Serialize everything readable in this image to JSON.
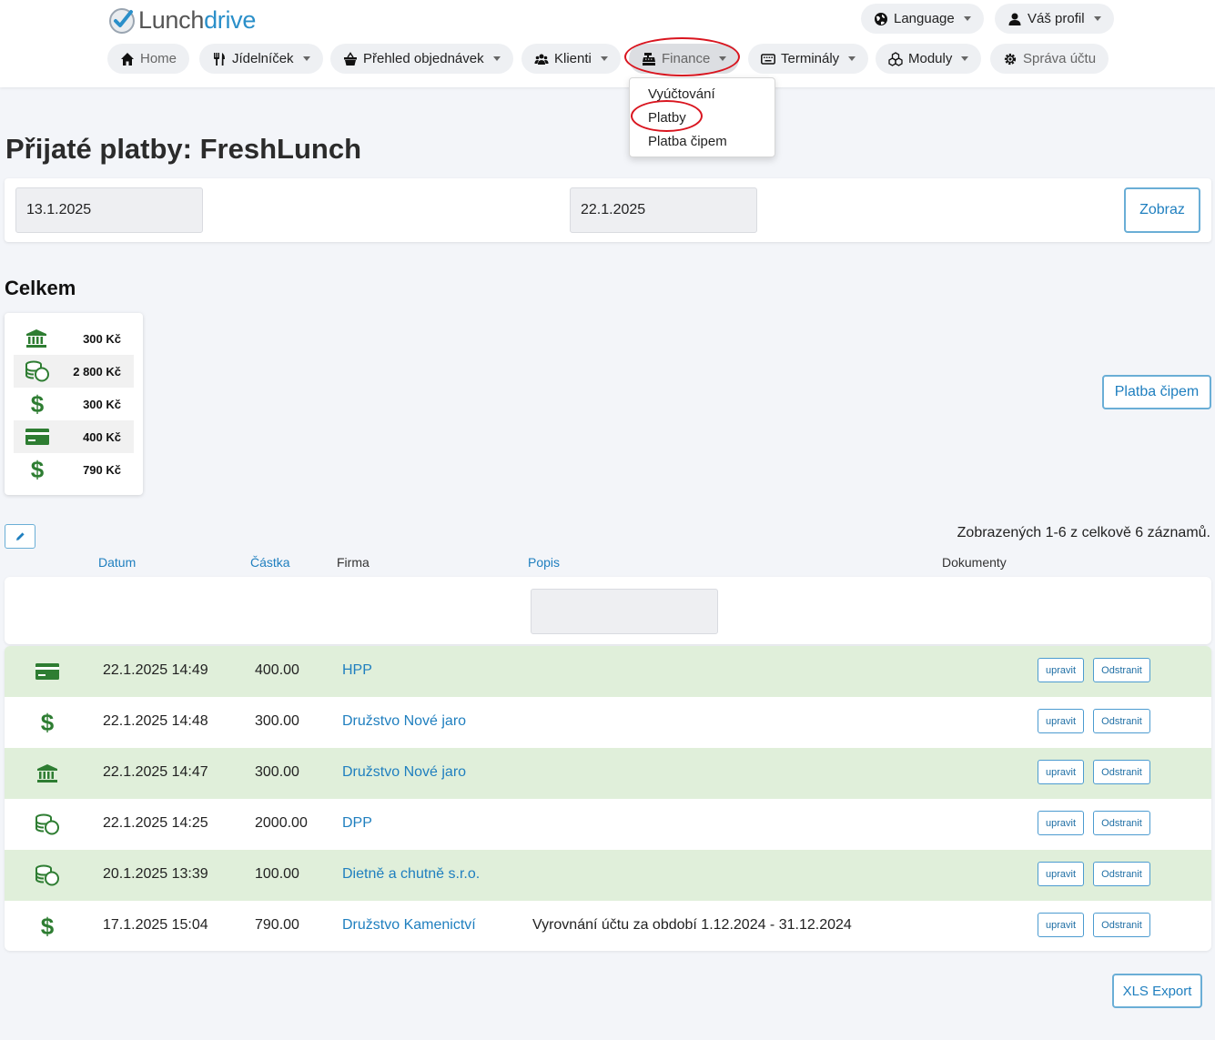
{
  "header": {
    "logo_part1": "Lunch",
    "logo_part2": "drive",
    "language": "Language",
    "profile": "Váš profil"
  },
  "nav": {
    "home": "Home",
    "menu": "Jídelníček",
    "orders": "Přehled objednávek",
    "clients": "Klienti",
    "finance": "Finance",
    "terminals": "Terminály",
    "modules": "Moduly",
    "account": "Správa účtu"
  },
  "finance_menu": {
    "items": [
      "Vyúčtování",
      "Platby",
      "Platba čipem"
    ]
  },
  "page": {
    "title": "Přijaté platby: FreshLunch"
  },
  "filter": {
    "date_from": "13.1.2025",
    "date_to": "22.1.2025",
    "show_button": "Zobraz"
  },
  "summary": {
    "heading": "Celkem",
    "rows": [
      {
        "icon": "bank-icon",
        "amount": "300 Kč"
      },
      {
        "icon": "coins-icon",
        "amount": "2 800 Kč"
      },
      {
        "icon": "dollar-icon",
        "amount": "300 Kč"
      },
      {
        "icon": "card-icon",
        "amount": "400 Kč"
      },
      {
        "icon": "dollar-icon",
        "amount": "790 Kč"
      }
    ]
  },
  "chip_payment_button": "Platba čipem",
  "records_info": "Zobrazených 1-6 z celkově 6 záznamů.",
  "table": {
    "headers": {
      "date": "Datum",
      "amount": "Částka",
      "firm": "Firma",
      "description": "Popis",
      "documents": "Dokumenty"
    },
    "rows": [
      {
        "icon": "card-icon",
        "date": "22.1.2025 14:49",
        "amount": "400.00",
        "firm": "HPP",
        "description": ""
      },
      {
        "icon": "dollar-icon",
        "date": "22.1.2025 14:48",
        "amount": "300.00",
        "firm": "Družstvo Nové jaro",
        "description": ""
      },
      {
        "icon": "bank-icon",
        "date": "22.1.2025 14:47",
        "amount": "300.00",
        "firm": "Družstvo Nové jaro",
        "description": ""
      },
      {
        "icon": "coins-icon",
        "date": "22.1.2025 14:25",
        "amount": "2000.00",
        "firm": "DPP",
        "description": ""
      },
      {
        "icon": "coins-icon",
        "date": "20.1.2025 13:39",
        "amount": "100.00",
        "firm": "Dietně a chutně s.r.o.",
        "description": ""
      },
      {
        "icon": "dollar-icon",
        "date": "17.1.2025 15:04",
        "amount": "790.00",
        "firm": "Družstvo Kamenictví",
        "description": "Vyrovnání účtu za období 1.12.2024 - 31.12.2024"
      }
    ],
    "edit_label": "upravit",
    "delete_label": "Odstranit"
  },
  "export_button": "XLS Export",
  "colors": {
    "accent": "#1f7fbf",
    "icon_green": "#2e7d32",
    "row_alt": "#e0efda",
    "highlight": "#d9151f"
  }
}
